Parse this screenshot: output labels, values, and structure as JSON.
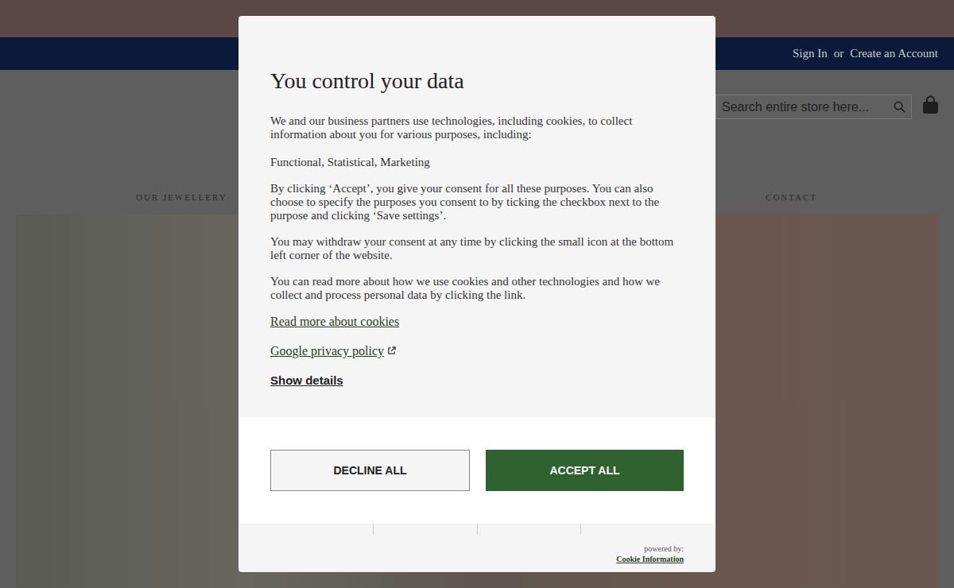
{
  "header": {
    "account_links": [
      "Sign In",
      "or",
      "Create an Account"
    ],
    "search": {
      "placeholder": "Search entire store here..."
    },
    "nav": [
      "OUR JEWELLERY",
      "CONTACT"
    ]
  },
  "dialog": {
    "title": "You control your data",
    "intro": "We and our business partners use technologies, including cookies, to collect information about you for various purposes, including:",
    "purposes": "Functional, Statistical, Marketing",
    "paragraphs": [
      "By clicking ‘Accept’, you give your consent for all these purposes. You can also choose to specify the purposes you consent to by ticking the checkbox next to the purpose and clicking ‘Save settings’.",
      "You may withdraw your consent at any time by clicking the small icon at the bottom left corner of the website.",
      "You can read more about how we use cookies and other technologies and how we collect and process personal data by clicking the link."
    ],
    "links": [
      {
        "label": "Read more about cookies",
        "external": false
      },
      {
        "label": "Google privacy policy",
        "external": true
      }
    ],
    "details": "Show details",
    "buttons": [
      "DECLINE ALL",
      "ACCEPT ALL"
    ],
    "powered_by": "powered by:",
    "brand": "Cookie Information"
  }
}
